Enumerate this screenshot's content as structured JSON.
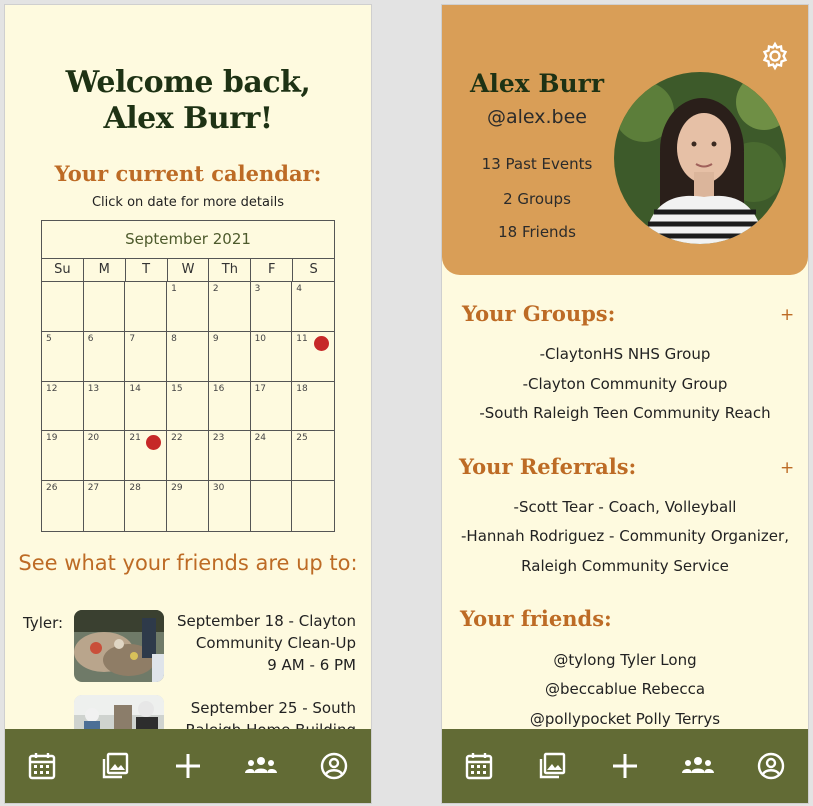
{
  "home": {
    "welcome_line1": "Welcome back,",
    "welcome_line2": "Alex Burr!",
    "calendar_heading": "Your current calendar:",
    "calendar_hint": "Click on date for more details",
    "calendar": {
      "month": "September 2021",
      "weekdays": [
        "Su",
        "M",
        "T",
        "W",
        "Th",
        "F",
        "S"
      ],
      "weeks": [
        [
          "",
          "",
          "",
          "1",
          "2",
          "3",
          "4"
        ],
        [
          "5",
          "6",
          "7",
          "8",
          "9",
          "10",
          "11"
        ],
        [
          "12",
          "13",
          "14",
          "15",
          "16",
          "17",
          "18"
        ],
        [
          "19",
          "20",
          "21",
          "22",
          "23",
          "24",
          "25"
        ],
        [
          "26",
          "27",
          "28",
          "29",
          "30",
          "",
          ""
        ]
      ],
      "event_days": [
        "11",
        "21"
      ],
      "event_color": "#c62828"
    },
    "friends_heading": "See what your friends are up to:",
    "activities": [
      {
        "friend": "Tyler:",
        "line1": "September 18 - Clayton",
        "line2": "Community Clean-Up",
        "line3": "9 AM - 6 PM"
      },
      {
        "friend": "",
        "line1": "September 25 -  South",
        "line2": "Raleigh Home Building",
        "line3": ""
      }
    ]
  },
  "profile": {
    "name": "Alex Burr",
    "handle": "@alex.bee",
    "past_events": "13 Past Events",
    "groups_count": "2 Groups",
    "friends_count": "18 Friends",
    "groups_heading": "Your Groups:",
    "groups": [
      "-ClaytonHS NHS Group",
      "-Clayton Community Group",
      "-South Raleigh Teen Community Reach"
    ],
    "referrals_heading": "Your Referrals:",
    "referrals": [
      "-Scott Tear - Coach, Volleyball",
      "-Hannah Rodriguez - Community Organizer,",
      "Raleigh Community Service"
    ],
    "friends_heading": "Your friends:",
    "friends": [
      "@tylong  Tyler Long",
      "@beccablue  Rebecca",
      "@pollypocket Polly Terrys"
    ],
    "add_label": "+"
  },
  "nav": {
    "icons": [
      "calendar-icon",
      "gallery-icon",
      "add-icon",
      "groups-icon",
      "profile-icon"
    ]
  },
  "colors": {
    "background": "#fefadf",
    "nav": "#626b35",
    "accent": "#bd6b25",
    "profile_card": "#d99e57",
    "title": "#1e3214"
  }
}
